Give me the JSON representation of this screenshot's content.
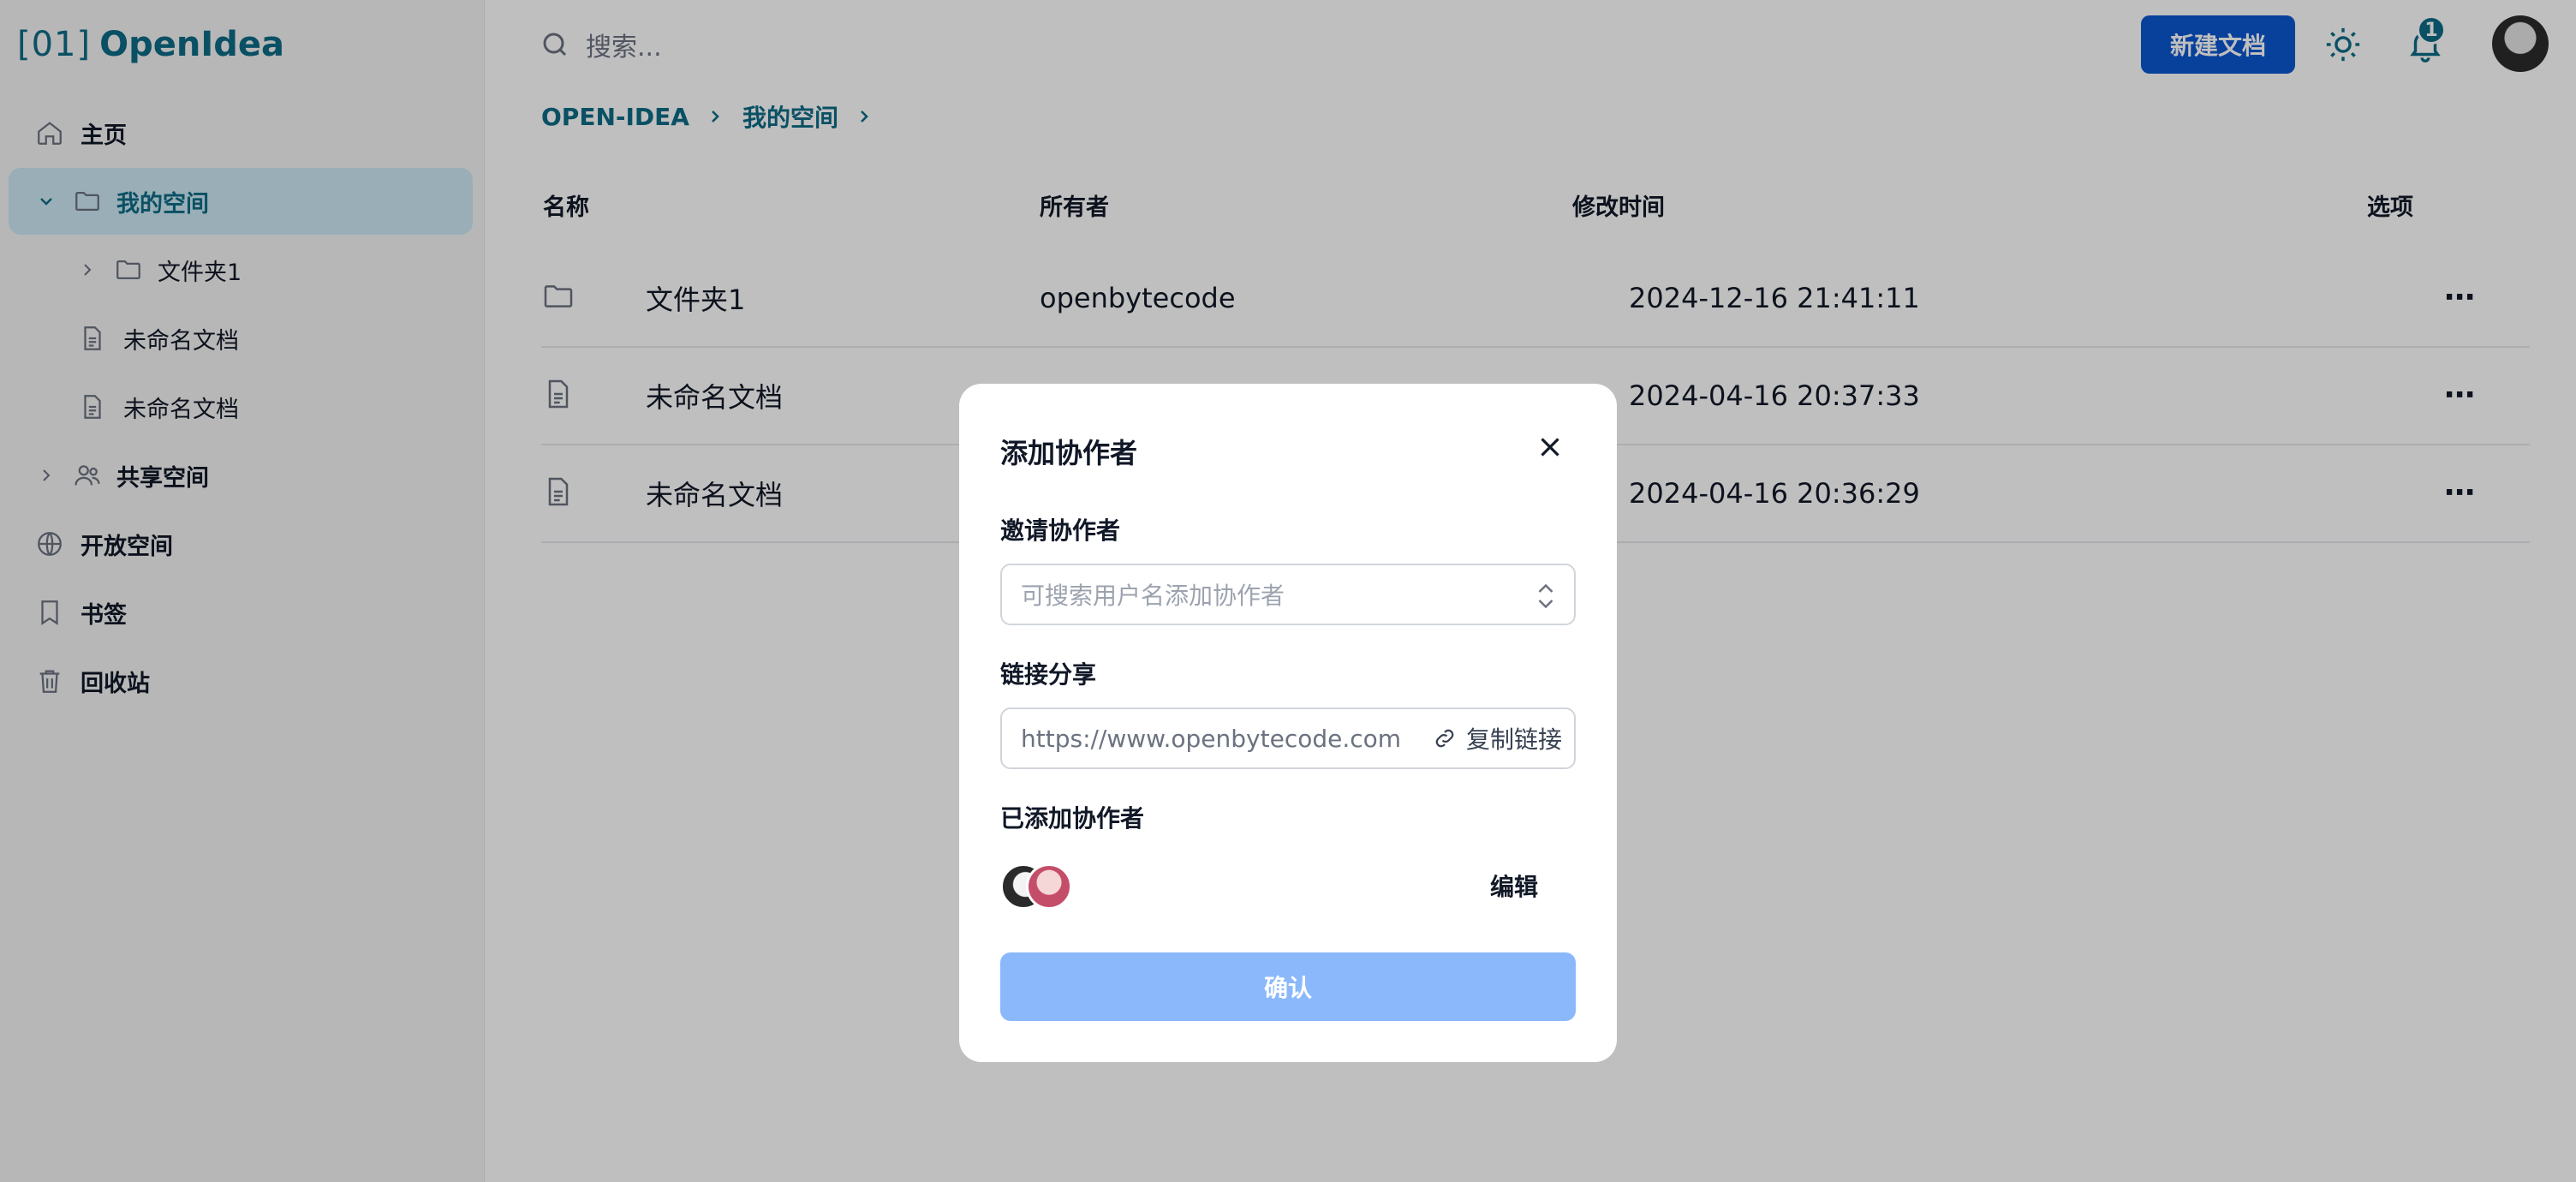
{
  "logo": {
    "bracket": "[01]",
    "name": "OpenIdea"
  },
  "sidebar": {
    "items": [
      {
        "label": "主页",
        "icon": "home-icon"
      },
      {
        "label": "我的空间",
        "icon": "folder-icon",
        "active": true
      },
      {
        "label": "文件夹1",
        "icon": "folder-icon"
      },
      {
        "label": "未命名文档",
        "icon": "document-icon"
      },
      {
        "label": "未命名文档",
        "icon": "document-icon"
      },
      {
        "label": "共享空间",
        "icon": "users-icon"
      },
      {
        "label": "开放空间",
        "icon": "globe-icon"
      },
      {
        "label": "书签",
        "icon": "bookmark-icon"
      },
      {
        "label": "回收站",
        "icon": "trash-icon"
      }
    ]
  },
  "header": {
    "search_placeholder": "搜索...",
    "new_doc_label": "新建文档",
    "notification_count": "1"
  },
  "breadcrumb": [
    "OPEN-IDEA",
    "我的空间"
  ],
  "table": {
    "headers": {
      "name": "名称",
      "owner": "所有者",
      "modified": "修改时间",
      "options": "选项"
    },
    "rows": [
      {
        "type": "folder",
        "name": "文件夹1",
        "owner": "openbytecode",
        "modified": "2024-12-16 21:41:11",
        "more": "⋯"
      },
      {
        "type": "doc",
        "name": "未命名文档",
        "owner": "",
        "modified": "2024-04-16 20:37:33",
        "more": "⋯"
      },
      {
        "type": "doc",
        "name": "未命名文档",
        "owner": "",
        "modified": "2024-04-16 20:36:29",
        "more": "⋯"
      }
    ]
  },
  "modal": {
    "title": "添加协作者",
    "invite_label": "邀请协作者",
    "invite_placeholder": "可搜索用户名添加协作者",
    "link_label": "链接分享",
    "link_value": "https://www.openbytecode.com",
    "copy_link": "复制链接",
    "added_label": "已添加协作者",
    "edit": "编辑",
    "confirm": "确认"
  },
  "colors": {
    "accent": "#0e6b86",
    "primary_button": "#0b57d0",
    "confirm_disabled": "#8ab8fb"
  }
}
